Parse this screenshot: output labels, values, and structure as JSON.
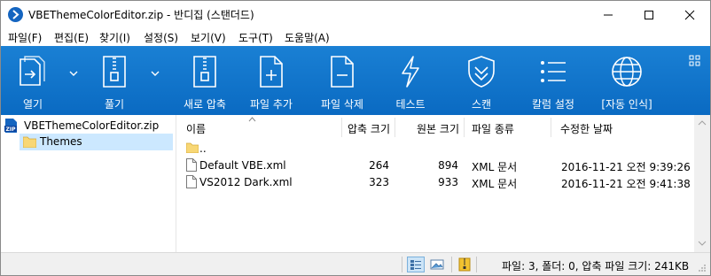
{
  "window": {
    "title": "VBEThemeColorEditor.zip - 반디집 (스탠더드)"
  },
  "menu": [
    "파일(F)",
    "편집(E)",
    "찾기(I)",
    "설정(S)",
    "보기(V)",
    "도구(T)",
    "도움말(A)"
  ],
  "toolbar": [
    {
      "label": "열기",
      "icon": "open-icon"
    },
    {
      "label": "풀기",
      "icon": "extract-icon"
    },
    {
      "label": "새로 압축",
      "icon": "new-archive-icon"
    },
    {
      "label": "파일 추가",
      "icon": "add-file-icon"
    },
    {
      "label": "파일 삭제",
      "icon": "delete-file-icon"
    },
    {
      "label": "테스트",
      "icon": "test-icon"
    },
    {
      "label": "스캔",
      "icon": "scan-icon"
    },
    {
      "label": "칼럼 설정",
      "icon": "column-settings-icon"
    },
    {
      "label": "[자동 인식]",
      "icon": "codepage-globe-icon"
    }
  ],
  "tree": {
    "root": "VBEThemeColorEditor.zip",
    "children": [
      "Themes"
    ]
  },
  "columns": {
    "name": "이름",
    "packed": "압축 크기",
    "original": "원본 크기",
    "type": "파일 종류",
    "modified": "수정한 날짜"
  },
  "files": [
    {
      "name": "..",
      "packed": "",
      "original": "",
      "type": "",
      "modified": ""
    },
    {
      "name": "Default VBE.xml",
      "packed": "264",
      "original": "894",
      "type": "XML 문서",
      "modified": "2016-11-21 오전 9:39:26"
    },
    {
      "name": "VS2012 Dark.xml",
      "packed": "323",
      "original": "933",
      "type": "XML 문서",
      "modified": "2016-11-21 오전 9:41:38"
    }
  ],
  "status": {
    "text": "파일: 3, 폴더: 0, 압축 파일 크기: 241KB"
  },
  "colors": {
    "toolbar": "#0a6ac2",
    "selection": "#cce8ff",
    "folder": "#f8d775"
  }
}
